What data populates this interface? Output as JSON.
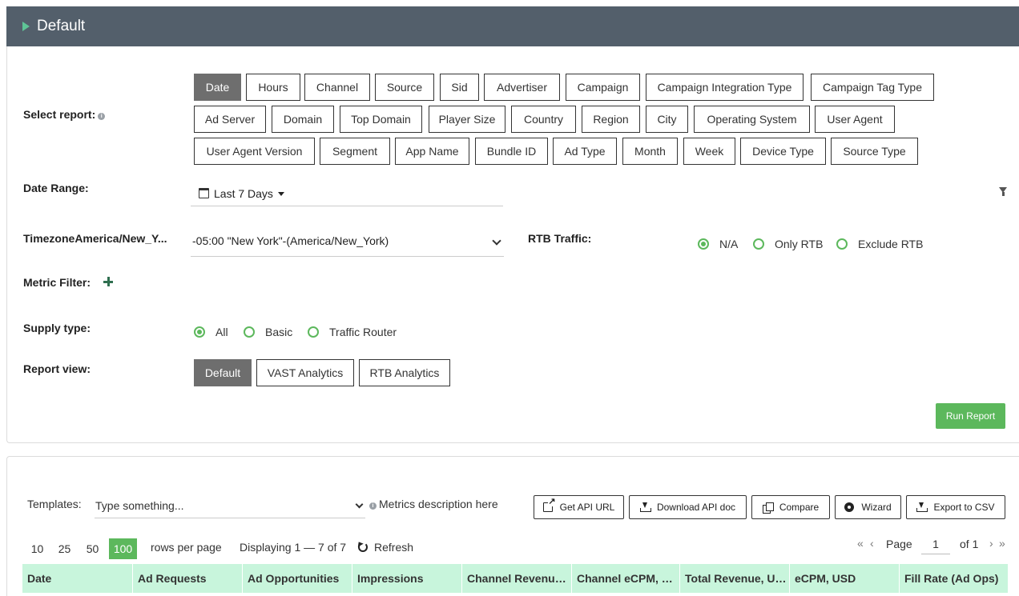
{
  "header": {
    "title": "Default"
  },
  "select_report": {
    "label": "Select report:",
    "chips": [
      "Date",
      "Hours",
      "Channel",
      "Source",
      "Sid",
      "Advertiser",
      "Campaign",
      "Campaign Integration Type",
      "Campaign Tag Type",
      "Ad Server",
      "Domain",
      "Top Domain",
      "Player Size",
      "Country",
      "Region",
      "City",
      "Operating System",
      "User Agent",
      "User Agent Version",
      "Segment",
      "App Name",
      "Bundle ID",
      "Ad Type",
      "Month",
      "Week",
      "Device Type",
      "Source Type"
    ],
    "active": "Date"
  },
  "date_range": {
    "label": "Date Range:",
    "value": "Last 7 Days"
  },
  "timezone": {
    "label": "TimezoneAmerica/New_Y...",
    "value": "-05:00 \"New York\"-(America/New_York)"
  },
  "rtb_traffic": {
    "label": "RTB Traffic:",
    "options": [
      "N/A",
      "Only RTB",
      "Exclude RTB"
    ],
    "selected": "N/A"
  },
  "metric_filter": {
    "label": "Metric Filter:"
  },
  "supply_type": {
    "label": "Supply type:",
    "options": [
      "All",
      "Basic",
      "Traffic Router"
    ],
    "selected": "All"
  },
  "report_view": {
    "label": "Report view:",
    "options": [
      "Default",
      "VAST Analytics",
      "RTB Analytics"
    ],
    "selected": "Default"
  },
  "run_report": "Run Report",
  "templates": {
    "label": "Templates:",
    "placeholder": "Type something...",
    "metrics_desc": "Metrics description here"
  },
  "toolbar": {
    "get_api_url": "Get API URL",
    "download_api_doc": "Download API doc",
    "compare": "Compare",
    "wizard": "Wizard",
    "export_csv": "Export to CSV"
  },
  "pagination": {
    "sizes": [
      "10",
      "25",
      "50",
      "100"
    ],
    "active_size": "100",
    "rows_per_page": "rows per page",
    "displaying": "Displaying 1 — 7 of 7",
    "refresh": "Refresh",
    "page_label": "Page",
    "page_value": "1",
    "of_label": "of 1"
  },
  "table": {
    "columns": [
      "Date",
      "Ad Requests",
      "Ad Opportunities",
      "Impressions",
      "Channel Revenue, USD",
      "Channel eCPM, USD",
      "Total Revenue, USD",
      "eCPM, USD",
      "Fill Rate (Ad Ops)"
    ]
  },
  "colors": {
    "header_bg": "#535f6b",
    "accent_green": "#5cb85c",
    "table_header_bg": "#c8f5dc"
  }
}
